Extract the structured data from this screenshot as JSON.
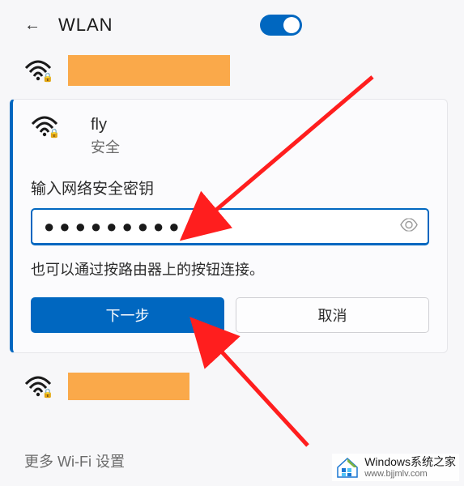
{
  "header": {
    "title": "WLAN",
    "toggle_on": true
  },
  "networks": {
    "above": {
      "redacted": true
    },
    "active": {
      "ssid": "fly",
      "subtitle": "安全",
      "password_label": "输入网络安全密钥",
      "password_value": "●●●●●●●●●●●",
      "hint": "也可以通过按路由器上的按钮连接。",
      "btn_next": "下一步",
      "btn_cancel": "取消"
    },
    "below": {
      "redacted": true
    }
  },
  "more_settings": "更多 Wi-Fi 设置",
  "watermark": {
    "top": "Windows系统之家",
    "bottom": "www.bjjmlv.com"
  },
  "colors": {
    "accent": "#0067c0",
    "redact": "#faa94a"
  }
}
